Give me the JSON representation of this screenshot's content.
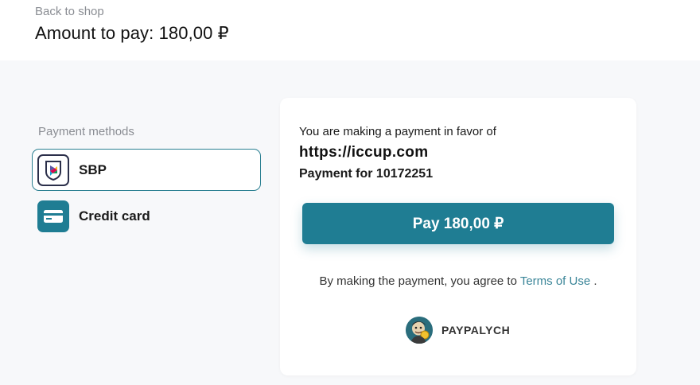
{
  "header": {
    "back_label": "Back to shop",
    "amount_label": "Amount to pay: 180,00 ₽"
  },
  "methods": {
    "title": "Payment methods",
    "items": [
      {
        "label": "SBP",
        "icon": "sbp-icon",
        "selected": true
      },
      {
        "label": "Credit card",
        "icon": "credit-card-icon",
        "selected": false
      }
    ]
  },
  "payment": {
    "favor_text": "You are making a payment in favor of",
    "site": "https://iccup.com",
    "description": "Payment for 10172251",
    "pay_button": "Pay 180,00 ₽",
    "terms_prefix": "By making the payment, you agree to",
    "terms_link": "Terms of Use",
    "terms_suffix": "."
  },
  "brand": {
    "name": "PAYPALYCH",
    "logo_icon": "paypalych-logo-icon"
  },
  "colors": {
    "accent": "#1f7d93",
    "muted_text": "#8a8d93",
    "background": "#f7f8fa"
  }
}
